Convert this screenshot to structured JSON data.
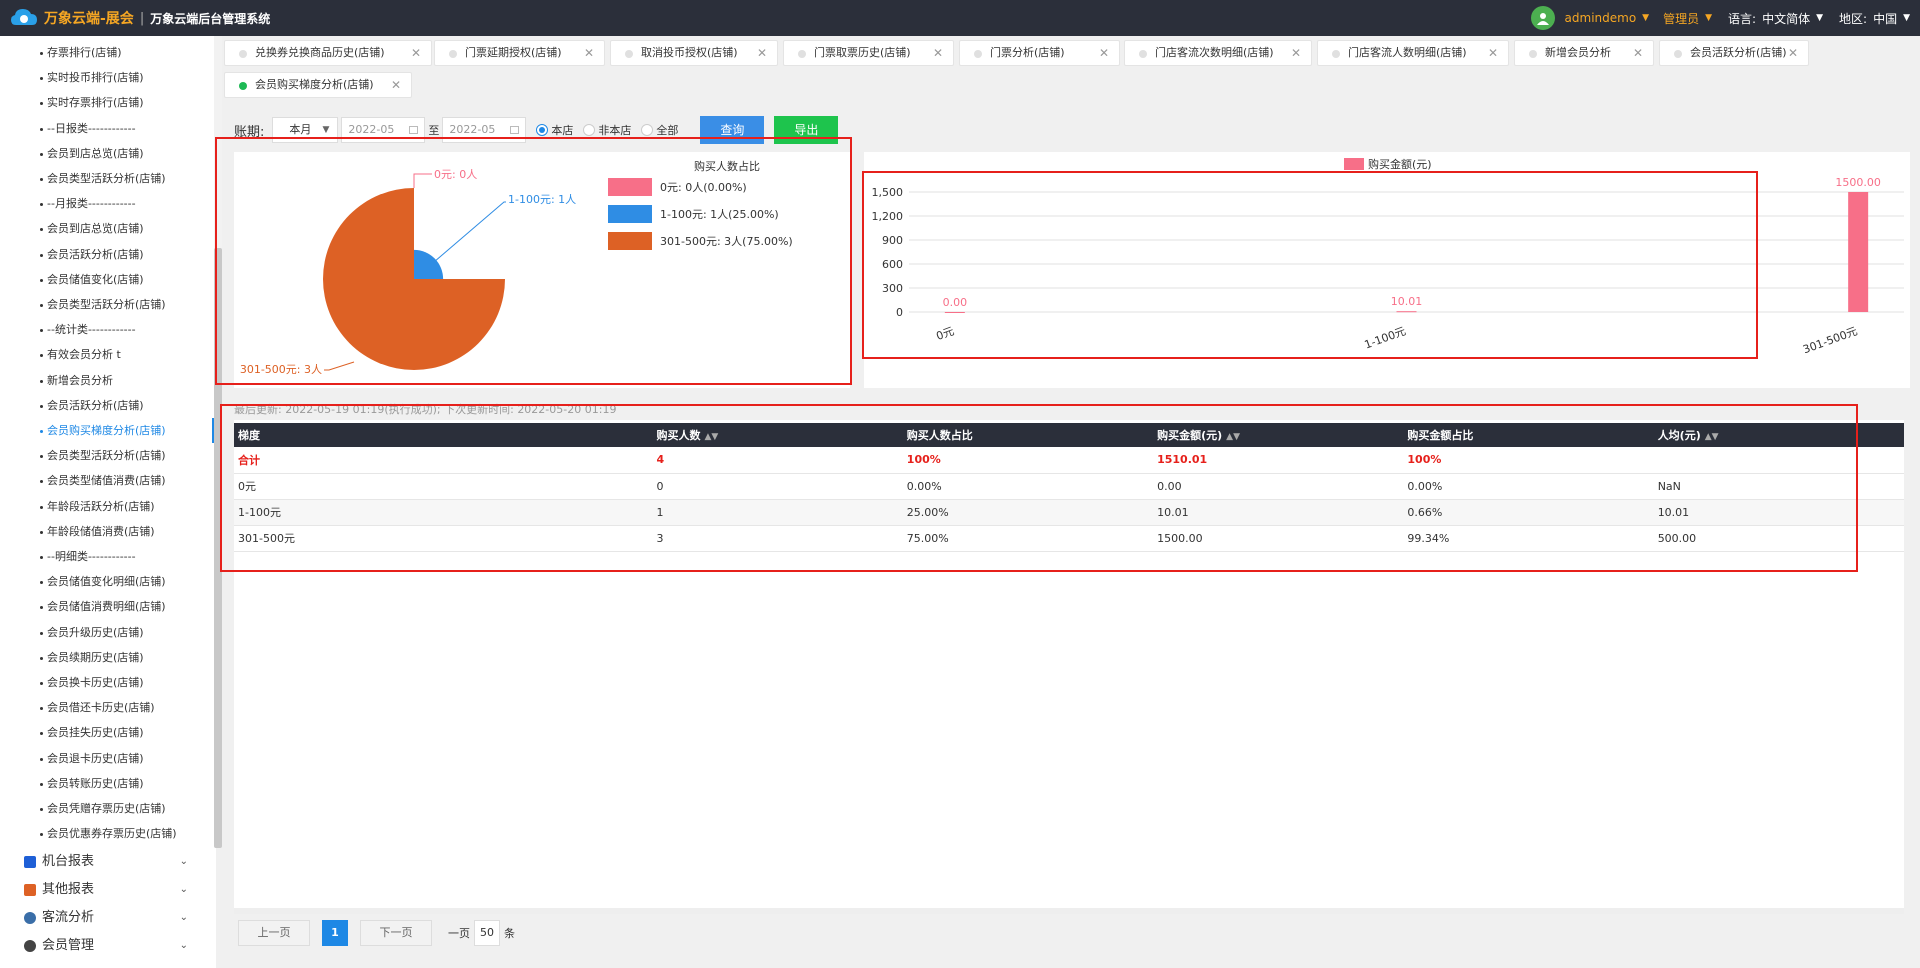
{
  "header": {
    "brand": "万象云端-展会",
    "separator": "|",
    "subtitle": "万象云端后台管理系统",
    "user": "admindemo",
    "role": "管理员",
    "lang_label": "语言:",
    "lang_value": "中文简体",
    "region_label": "地区:",
    "region_value": "中国"
  },
  "sidebar": {
    "items": [
      "存票排行(店铺)",
      "实时投币排行(店铺)",
      "实时存票排行(店铺)",
      "--日报类------------",
      "会员到店总览(店铺)",
      "会员类型活跃分析(店铺)",
      "--月报类------------",
      "会员到店总览(店铺)",
      "会员活跃分析(店铺)",
      "会员储值变化(店铺)",
      "会员类型活跃分析(店铺)",
      "--统计类------------",
      "有效会员分析 t",
      "新增会员分析",
      "会员活跃分析(店铺)",
      "会员购买梯度分析(店铺)",
      "会员类型活跃分析(店铺)",
      "会员类型储值消费(店铺)",
      "年龄段活跃分析(店铺)",
      "年龄段储值消费(店铺)",
      "--明细类------------",
      "会员储值变化明细(店铺)",
      "会员储值消费明细(店铺)",
      "会员升级历史(店铺)",
      "会员续期历史(店铺)",
      "会员换卡历史(店铺)",
      "会员借还卡历史(店铺)",
      "会员挂失历史(店铺)",
      "会员退卡历史(店铺)",
      "会员转账历史(店铺)",
      "会员凭赠存票历史(店铺)",
      "会员优惠券存票历史(店铺)"
    ],
    "active_index": 15,
    "groups": [
      "机台报表",
      "其他报表",
      "客流分析",
      "会员管理"
    ]
  },
  "tabs": [
    "兑换券兑换商品历史(店铺)",
    "门票延期授权(店铺)",
    "取消投币授权(店铺)",
    "门票取票历史(店铺)",
    "门票分析(店铺)",
    "门店客流次数明细(店铺)",
    "门店客流人数明细(店铺)",
    "新增会员分析",
    "会员活跃分析(店铺)",
    "会员购买梯度分析(店铺)"
  ],
  "filter": {
    "label": "账期:",
    "period": "本月",
    "start": "2022-05",
    "to": "至",
    "end": "2022-05",
    "radios": [
      "本店",
      "非本店",
      "全部"
    ],
    "query": "查询",
    "export": "导出"
  },
  "pie": {
    "title": "购买人数占比",
    "labels": [
      "0元: 0人",
      "1-100元: 1人",
      "301-500元: 3人"
    ],
    "legend": [
      "0元: 0人(0.00%)",
      "1-100元: 1人(25.00%)",
      "301-500元: 3人(75.00%)"
    ],
    "colors": [
      "#f76f88",
      "#2f8de4",
      "#dd6125"
    ]
  },
  "chart_data": {
    "type": "bar",
    "legend": "购买金额(元)",
    "categories": [
      "0元",
      "1-100元",
      "301-500元"
    ],
    "values": [
      0.0,
      10.01,
      1500.0
    ],
    "value_labels": [
      "0.00",
      "10.01",
      "1500.00"
    ],
    "yticks": [
      "0",
      "300",
      "600",
      "900",
      "1,200",
      "1,500"
    ],
    "ylim": [
      0,
      1500
    ],
    "color": "#f76f88"
  },
  "update_text": "最后更新: 2022-05-19 01:19(执行成功); 下次更新时间: 2022-05-20 01:19",
  "table": {
    "headers": [
      "梯度",
      "购买人数",
      "购买人数占比",
      "购买金额(元)",
      "购买金额占比",
      "人均(元)"
    ],
    "rows": [
      [
        "合计",
        "4",
        "100%",
        "1510.01",
        "100%",
        ""
      ],
      [
        "0元",
        "0",
        "0.00%",
        "0.00",
        "0.00%",
        "NaN"
      ],
      [
        "1-100元",
        "1",
        "25.00%",
        "10.01",
        "0.66%",
        "10.01"
      ],
      [
        "301-500元",
        "3",
        "75.00%",
        "1500.00",
        "99.34%",
        "500.00"
      ]
    ]
  },
  "pager": {
    "prev": "上一页",
    "page": "1",
    "next": "下一页",
    "per_label": "一页",
    "per": "50",
    "unit": "条"
  }
}
